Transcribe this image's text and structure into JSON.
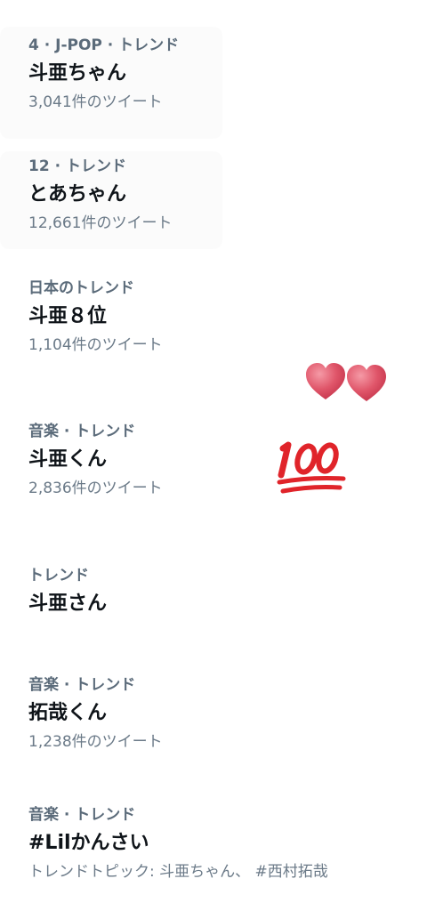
{
  "trends": [
    {
      "meta": "4 · J-POP · トレンド",
      "title": "斗亜ちゃん",
      "count": "3,041件のツイート"
    },
    {
      "meta": "12 · トレンド",
      "title": "とあちゃん",
      "count": "12,661件のツイート"
    },
    {
      "meta": "日本のトレンド",
      "title": "斗亜８位",
      "count": "1,104件のツイート"
    },
    {
      "meta": "音楽 · トレンド",
      "title": "斗亜くん",
      "count": "2,836件のツイート"
    },
    {
      "meta": "トレンド",
      "title": "斗亜さん"
    },
    {
      "meta": "音楽 · トレンド",
      "title": "拓哉くん",
      "count": "1,238件のツイート"
    },
    {
      "meta": "音楽 · トレンド",
      "title": "#Lilかんさい",
      "count": "トレンドトピック: 斗亜ちゃん、 #西村拓哉"
    }
  ],
  "stickers": {
    "hearts_icon": "two-hearts-icon",
    "hundred_icon": "hundred-points-icon",
    "hundred_color": "#e0242a",
    "heart_color": "#e0566a"
  }
}
